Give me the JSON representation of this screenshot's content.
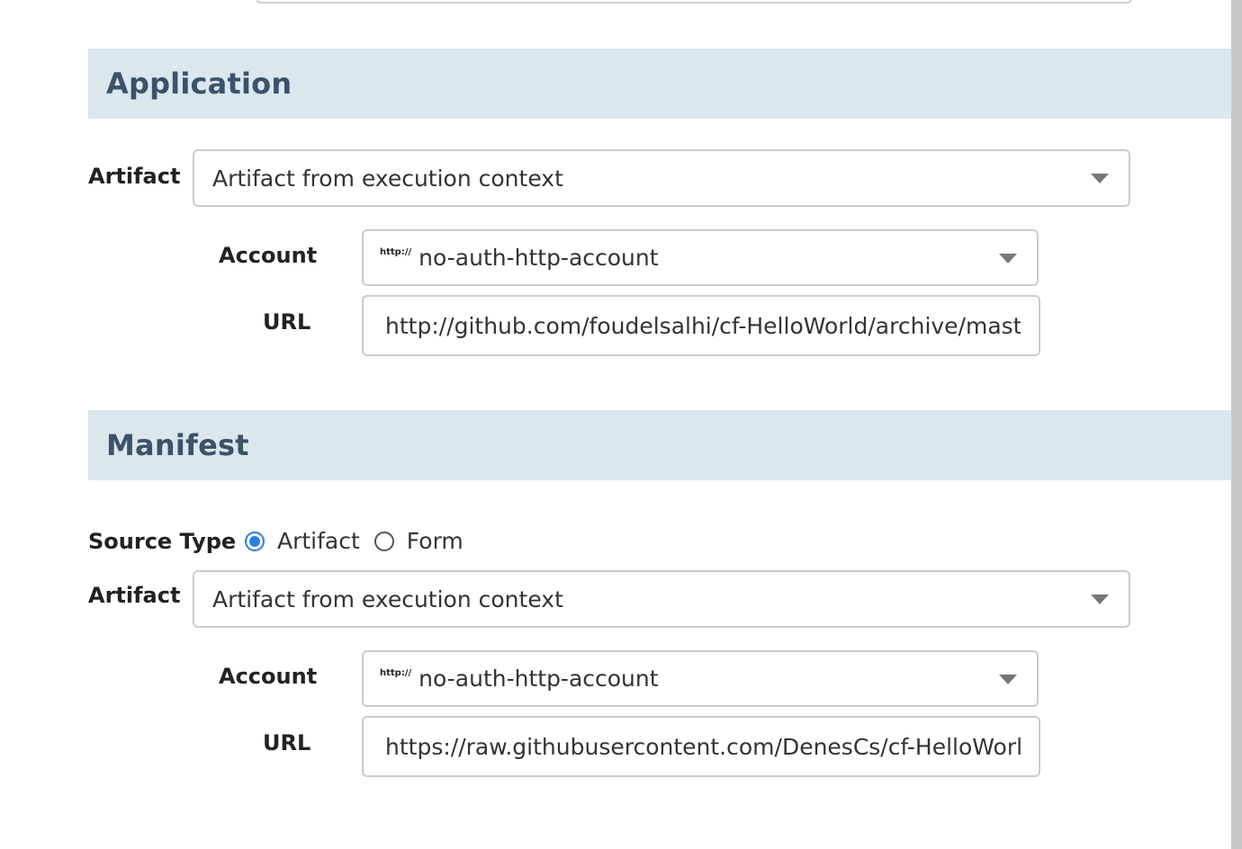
{
  "application": {
    "title": "Application",
    "artifact_label": "Artifact",
    "artifact_value": "Artifact from execution context",
    "account_label": "Account",
    "account_badge": "http://",
    "account_value": "no-auth-http-account",
    "url_label": "URL",
    "url_value": "http://github.com/foudelsalhi/cf-HelloWorld/archive/master"
  },
  "manifest": {
    "title": "Manifest",
    "source_type_label": "Source Type",
    "source_options": [
      {
        "label": "Artifact",
        "checked": true
      },
      {
        "label": "Form",
        "checked": false
      }
    ],
    "artifact_label": "Artifact",
    "artifact_value": "Artifact from execution context",
    "account_label": "Account",
    "account_badge": "http://",
    "account_value": "no-auth-http-account",
    "url_label": "URL",
    "url_value": "https://raw.githubusercontent.com/DenesCs/cf-HelloWorld/"
  },
  "colors": {
    "section_bg": "#dae7ed",
    "section_title": "#3b5269",
    "radio_accent": "#2a7de1"
  }
}
